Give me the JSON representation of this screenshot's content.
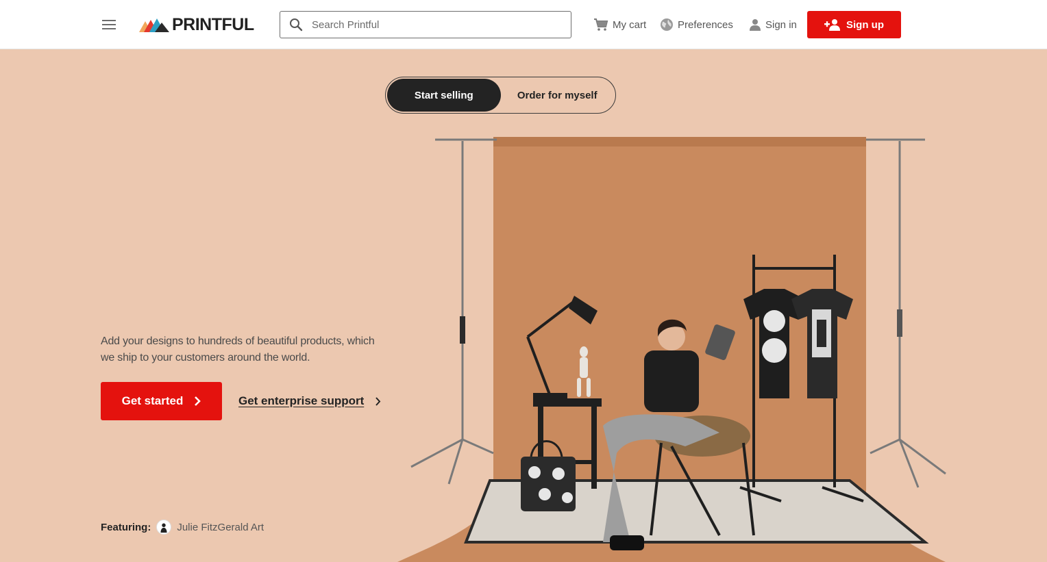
{
  "header": {
    "brand": "PRINTFUL",
    "search_placeholder": "Search Printful",
    "cart_label": "My cart",
    "preferences_label": "Preferences",
    "signin_label": "Sign in",
    "signup_label": "Sign up"
  },
  "hero": {
    "toggle": {
      "options": [
        "Start selling",
        "Order for myself"
      ],
      "selected": "Start selling"
    },
    "description": "Add your designs to hundreds of beautiful products, which we ship to your customers around the world.",
    "cta_label": "Get started",
    "enterprise_label": "Get enterprise support",
    "featuring_label": "Featuring:",
    "featuring_name": "Julie FitzGerald Art"
  },
  "colors": {
    "accent": "#e4120e",
    "hero_bg": "#ecc8b0",
    "backdrop": "#c98a5e",
    "dark": "#232323"
  },
  "icons": {
    "menu": "hamburger-icon",
    "search": "search-icon",
    "cart": "cart-icon",
    "preferences": "globe-icon",
    "signin": "user-icon",
    "signup": "add-user-icon",
    "cta": "chevron-right-icon",
    "enterprise": "chevron-right-icon"
  }
}
